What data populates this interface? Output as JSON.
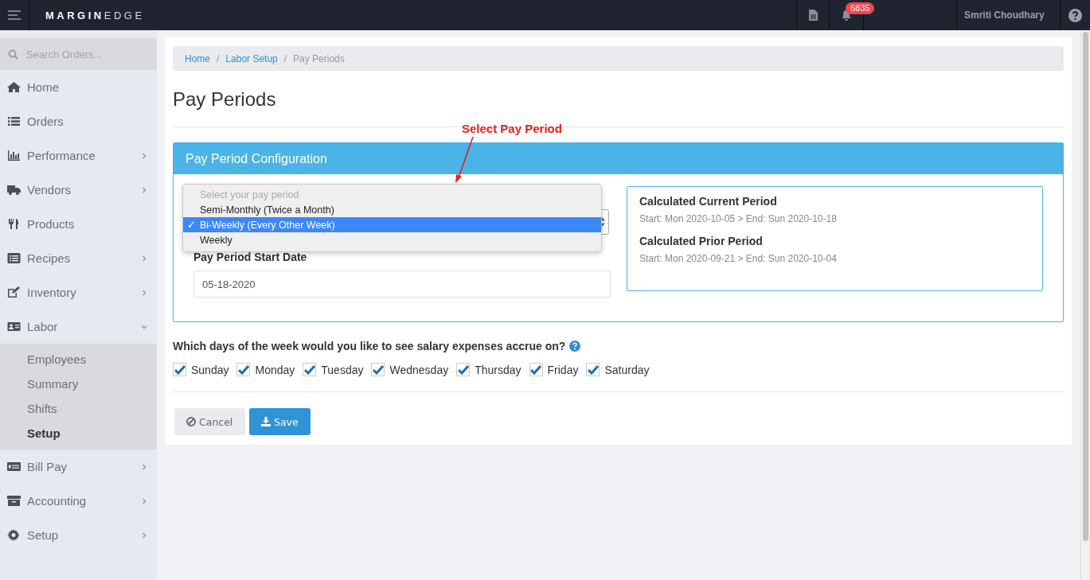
{
  "topbar": {
    "logo": {
      "bold": "MARGIN",
      "light": "EDGE"
    },
    "notifications": {
      "count": "6835"
    },
    "user": "Smriti Choudhary"
  },
  "sidebar": {
    "search": {
      "placeholder": "Search Orders..."
    },
    "items": [
      {
        "label": "Home",
        "kind": "link"
      },
      {
        "label": "Orders",
        "kind": "link"
      },
      {
        "label": "Performance",
        "kind": "group",
        "expanded": false
      },
      {
        "label": "Vendors",
        "kind": "group",
        "expanded": false
      },
      {
        "label": "Products",
        "kind": "link"
      },
      {
        "label": "Recipes",
        "kind": "group",
        "expanded": false
      },
      {
        "label": "Inventory",
        "kind": "group",
        "expanded": false
      },
      {
        "label": "Labor",
        "kind": "group",
        "expanded": true,
        "children": [
          {
            "label": "Employees",
            "selected": false
          },
          {
            "label": "Summary",
            "selected": false
          },
          {
            "label": "Shifts",
            "selected": false
          },
          {
            "label": "Setup",
            "selected": true
          }
        ]
      },
      {
        "label": "Bill Pay",
        "kind": "group",
        "expanded": false
      },
      {
        "label": "Accounting",
        "kind": "group",
        "expanded": false
      },
      {
        "label": "Setup",
        "kind": "group",
        "expanded": false
      }
    ]
  },
  "breadcrumb": {
    "separator": "/",
    "items": [
      {
        "label": "Home",
        "kind": "link"
      },
      {
        "label": "Labor Setup",
        "kind": "link"
      },
      {
        "label": "Pay Periods",
        "kind": "current"
      }
    ]
  },
  "page_title": "Pay Periods",
  "annotation": {
    "text": "Select Pay Period"
  },
  "card": {
    "title": "Pay Period Configuration",
    "pay_period_select": {
      "options": [
        {
          "label": "Select your pay period",
          "disabled": true,
          "selected": false
        },
        {
          "label": "Semi-Monthly (Twice a Month)",
          "disabled": false,
          "selected": false
        },
        {
          "label": "Bi-Weekly (Every Other Week)",
          "disabled": false,
          "selected": true
        },
        {
          "label": "Weekly",
          "disabled": false,
          "selected": false
        }
      ],
      "check_mark": "✓"
    },
    "start_date": {
      "label": "Pay Period Start Date",
      "value": "05-18-2020"
    },
    "periods": [
      {
        "title": "Calculated Current Period",
        "range": "Start: Mon 2020-10-05 > End: Sun 2020-10-18"
      },
      {
        "title": "Calculated Prior Period",
        "range": "Start: Mon 2020-09-21 > End: Sun 2020-10-04"
      }
    ]
  },
  "accrual": {
    "question": "Which days of the week would you like to see salary expenses accrue on?",
    "days": [
      {
        "label": "Sunday",
        "checked": true
      },
      {
        "label": "Monday",
        "checked": true
      },
      {
        "label": "Tuesday",
        "checked": true
      },
      {
        "label": "Wednesday",
        "checked": true
      },
      {
        "label": "Thursday",
        "checked": true
      },
      {
        "label": "Friday",
        "checked": true
      },
      {
        "label": "Saturday",
        "checked": true
      }
    ]
  },
  "buttons": [
    {
      "label": "Cancel",
      "kind": "cancel"
    },
    {
      "label": "Save",
      "kind": "save"
    }
  ]
}
